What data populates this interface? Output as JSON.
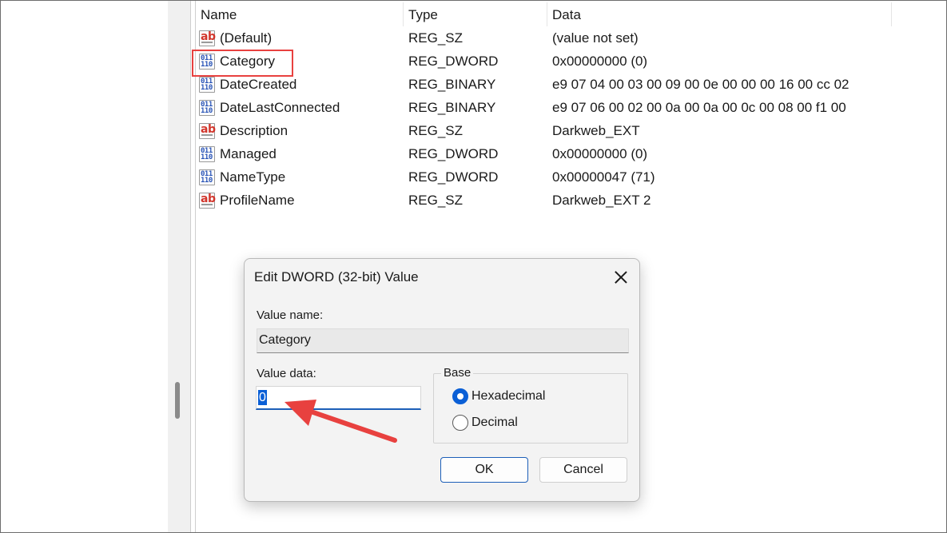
{
  "list": {
    "headers": {
      "name": "Name",
      "type": "Type",
      "data": "Data"
    },
    "rows": [
      {
        "icon": "string-value-icon",
        "name": "(Default)",
        "type": "REG_SZ",
        "data": "(value not set)"
      },
      {
        "icon": "binary-value-icon",
        "name": "Category",
        "type": "REG_DWORD",
        "data": "0x00000000 (0)"
      },
      {
        "icon": "binary-value-icon",
        "name": "DateCreated",
        "type": "REG_BINARY",
        "data": "e9 07 04 00 03 00 09 00 0e 00 00 00 16 00 cc 02"
      },
      {
        "icon": "binary-value-icon",
        "name": "DateLastConnected",
        "type": "REG_BINARY",
        "data": "e9 07 06 00 02 00 0a 00 0a 00 0c 00 08 00 f1 00"
      },
      {
        "icon": "string-value-icon",
        "name": "Description",
        "type": "REG_SZ",
        "data": "Darkweb_EXT"
      },
      {
        "icon": "binary-value-icon",
        "name": "Managed",
        "type": "REG_DWORD",
        "data": "0x00000000 (0)"
      },
      {
        "icon": "binary-value-icon",
        "name": "NameType",
        "type": "REG_DWORD",
        "data": "0x00000047 (71)"
      },
      {
        "icon": "string-value-icon",
        "name": "ProfileName",
        "type": "REG_SZ",
        "data": "Darkweb_EXT 2"
      }
    ],
    "icon_glyphs": {
      "string": "ab",
      "binary_top": "011",
      "binary_bottom": "110"
    }
  },
  "dialog": {
    "title": "Edit DWORD (32-bit) Value",
    "value_name_label": "Value name:",
    "value_name": "Category",
    "value_data_label": "Value data:",
    "value_data": "0",
    "base_label": "Base",
    "base_options": [
      {
        "label": "Hexadecimal",
        "selected": true
      },
      {
        "label": "Decimal",
        "selected": false
      }
    ],
    "ok_label": "OK",
    "cancel_label": "Cancel"
  },
  "annotation": {
    "highlight_target": "Category",
    "arrow_color": "#e8413f"
  },
  "colors": {
    "accent": "#0a5fd6",
    "highlight": "#e8413f",
    "string_icon": "#d2352b",
    "binary_icon": "#2a55b8"
  }
}
